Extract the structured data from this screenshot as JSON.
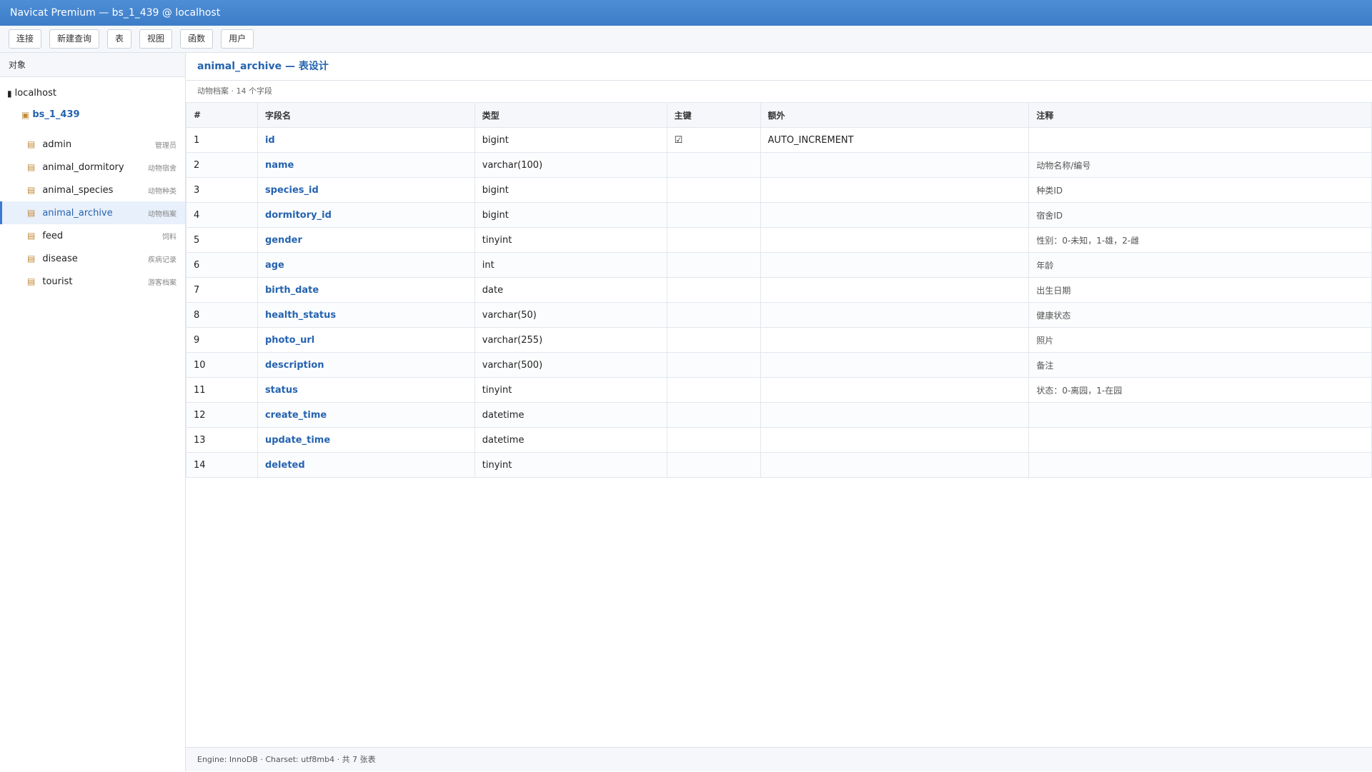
{
  "window": {
    "title": "Navicat Premium — bs_1_439 @ localhost"
  },
  "toolbar": {
    "buttons": [
      "连接",
      "新建查询",
      "表",
      "视图",
      "函数",
      "用户"
    ]
  },
  "sidebar": {
    "header": "对象",
    "host": {
      "icon": "server-icon",
      "label": "localhost"
    },
    "database": {
      "icon": "database-icon",
      "label": "bs_1_439"
    },
    "tables": [
      {
        "name": "admin",
        "comment": "管理员",
        "active": false
      },
      {
        "name": "animal_dormitory",
        "comment": "动物宿舍",
        "active": false
      },
      {
        "name": "animal_species",
        "comment": "动物种类",
        "active": false
      },
      {
        "name": "animal_archive",
        "comment": "动物档案",
        "active": true
      },
      {
        "name": "feed",
        "comment": "饲料",
        "active": false
      },
      {
        "name": "disease",
        "comment": "疾病记录",
        "active": false
      },
      {
        "name": "tourist",
        "comment": "游客档案",
        "active": false
      }
    ]
  },
  "main": {
    "title": "animal_archive — 表设计",
    "subinfo": "动物档案 · 14 个字段",
    "columns": [
      "#",
      "字段名",
      "类型",
      "主键",
      "额外",
      "注释"
    ],
    "rows": [
      [
        "1",
        "id",
        "bigint",
        "☑",
        "AUTO_INCREMENT",
        ""
      ],
      [
        "2",
        "name",
        "varchar(100)",
        "",
        "",
        "动物名称/编号"
      ],
      [
        "3",
        "species_id",
        "bigint",
        "",
        "",
        "种类ID"
      ],
      [
        "4",
        "dormitory_id",
        "bigint",
        "",
        "",
        "宿舍ID"
      ],
      [
        "5",
        "gender",
        "tinyint",
        "",
        "",
        "性别：0-未知，1-雄，2-雌"
      ],
      [
        "6",
        "age",
        "int",
        "",
        "",
        "年龄"
      ],
      [
        "7",
        "birth_date",
        "date",
        "",
        "",
        "出生日期"
      ],
      [
        "8",
        "health_status",
        "varchar(50)",
        "",
        "",
        "健康状态"
      ],
      [
        "9",
        "photo_url",
        "varchar(255)",
        "",
        "",
        "照片"
      ],
      [
        "10",
        "description",
        "varchar(500)",
        "",
        "",
        "备注"
      ],
      [
        "11",
        "status",
        "tinyint",
        "",
        "",
        "状态：0-离园，1-在园"
      ],
      [
        "12",
        "create_time",
        "datetime",
        "",
        "",
        ""
      ],
      [
        "13",
        "update_time",
        "datetime",
        "",
        "",
        ""
      ],
      [
        "14",
        "deleted",
        "tinyint",
        "",
        "",
        ""
      ]
    ]
  },
  "statusbar": {
    "text": "Engine: InnoDB · Charset: utf8mb4 · 共 7 张表"
  }
}
